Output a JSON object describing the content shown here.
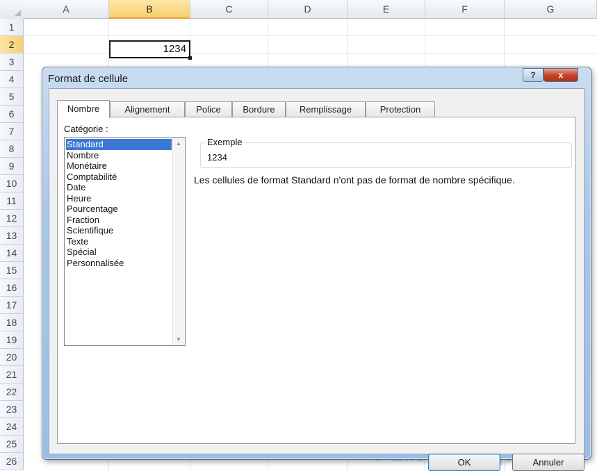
{
  "sheet": {
    "columns": [
      "A",
      "B",
      "C",
      "D",
      "E",
      "F",
      "G"
    ],
    "rows": [
      "1",
      "2",
      "3",
      "4",
      "5",
      "6",
      "7",
      "8",
      "9",
      "10",
      "11",
      "12",
      "13",
      "14",
      "15",
      "16",
      "17",
      "18",
      "19",
      "20",
      "21",
      "22",
      "23",
      "24",
      "25",
      "26"
    ],
    "selected_column": "B",
    "selected_row": "2",
    "active_cell_value": "1234"
  },
  "dialog": {
    "title": "Format de cellule",
    "help_icon": "?",
    "close_icon": "x",
    "tabs": [
      "Nombre",
      "Alignement",
      "Police",
      "Bordure",
      "Remplissage",
      "Protection"
    ],
    "active_tab": "Nombre",
    "category_label": "Catégorie :",
    "categories": [
      "Standard",
      "Nombre",
      "Monétaire",
      "Comptabilité",
      "Date",
      "Heure",
      "Pourcentage",
      "Fraction",
      "Scientifique",
      "Texte",
      "Spécial",
      "Personnalisée"
    ],
    "selected_category": "Standard",
    "sample_label": "Exemple",
    "sample_value": "1234",
    "description": "Les cellules de format Standard n'ont pas de format de nombre spécifique.",
    "ok_label": "OK",
    "cancel_label": "Annuler"
  },
  "watermark": "© Excel-Pratique.com",
  "colors": {
    "selection_blue": "#3a78d4",
    "header_highlight": "#f7cf6e",
    "dialog_frame": "#a9c6e6"
  }
}
